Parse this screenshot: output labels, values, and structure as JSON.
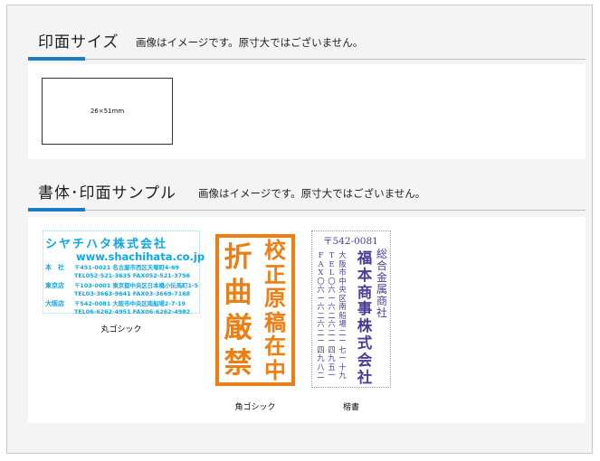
{
  "section_size": {
    "title": "印面サイズ",
    "note": "画像はイメージです。原寸大ではございません。",
    "size_label": "26×51mm"
  },
  "section_sample": {
    "title": "書体･印面サンプル",
    "note": "画像はイメージです。原寸大ではございません。"
  },
  "samples": [
    {
      "caption": "丸ゴシック",
      "company": "シヤチハタ株式会社",
      "url": "www.shachihata.co.jp",
      "rows": [
        {
          "label": "本　社",
          "text": "〒451-0021 名古屋市西区天塚町4-69"
        },
        {
          "label": "",
          "text": "TEL052-521-3635 FAX052-521-3756"
        },
        {
          "label": "東京店",
          "text": "〒103-0001 東京都中央区日本橋小伝馬町1-5"
        },
        {
          "label": "",
          "text": "TEL03-3663-9641 FAX03-3669-7168"
        },
        {
          "label": "大阪店",
          "text": "〒542-0081 大阪市中央区南船場2-7-19"
        },
        {
          "label": "",
          "text": "TEL06-6262-4951 FAX06-6262-4982"
        }
      ],
      "color": "#10a6e6"
    },
    {
      "caption": "角ゴシック",
      "col_left": "折曲厳禁",
      "col_right": "校正原稿在中",
      "color": "#ee7d12"
    },
    {
      "caption": "楷書",
      "zip": "〒542-0081",
      "col_tag": "総合金属商社",
      "col_company": "福本商事株式会社",
      "col_address": "大阪市中央区南船場二ー七ー十九",
      "col_tel": "TEL〇六ー六二六二ー四九五一",
      "col_fax": "FAX〇六ー六二六二ー四九八二",
      "color": "#4a3d99"
    }
  ]
}
